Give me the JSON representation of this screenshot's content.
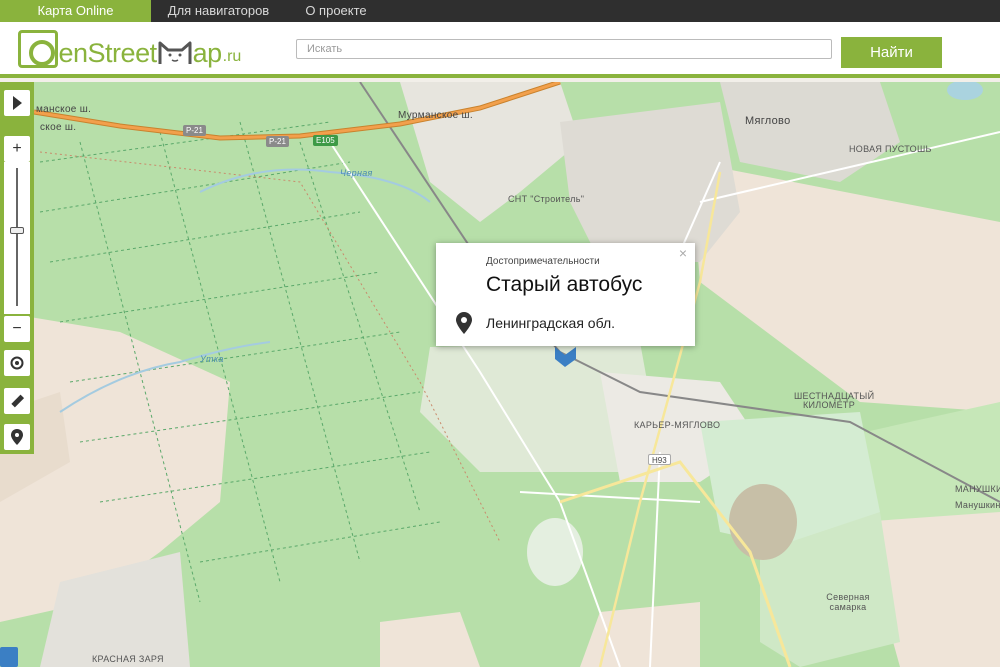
{
  "nav": {
    "tabs": [
      {
        "label": "Карта Online",
        "active": true
      },
      {
        "label": "Для навигаторов",
        "active": false
      },
      {
        "label": "О проекте",
        "active": false
      }
    ]
  },
  "header": {
    "logo_text": "penStreet",
    "logo_text2": "ap",
    "logo_suffix": ".ru",
    "search_placeholder": "Искать",
    "search_button": "Найти"
  },
  "toolbar": {
    "expand_icon": "chevron-right-icon",
    "zoom_in": "+",
    "zoom_out": "−",
    "zoom_level_fraction": 0.55,
    "tools": [
      "locate-icon",
      "ruler-icon",
      "pin-icon"
    ]
  },
  "popup": {
    "category": "Достопримечательности",
    "title": "Старый автобус",
    "address": "Ленинградская обл.",
    "close": "×"
  },
  "map_labels": {
    "road_1": "манское ш.",
    "road_2": "Р-21",
    "road_3": "Мурманское ш.",
    "road_4": "Р-21",
    "road_5": "E105",
    "road_6": "Р-21",
    "river_1": "Черная",
    "river_2": "Утка",
    "place_1": "Мяглово",
    "place_2": "НОВАЯ ПУСТОШЬ",
    "place_3": "СНТ \"Строитель\"",
    "place_4": "ШЕСТНАДЦАТЫЙ КИЛОМЕТР",
    "place_5": "КАРЬЕР-МЯГЛОВО",
    "place_6": "Н93",
    "place_7": "МАНУШКИНО",
    "place_8": "Манушкино",
    "place_9": "Северная самарка",
    "place_10": "КРАСНАЯ ЗАРЯ",
    "road_7": "ское ш."
  },
  "colors": {
    "accent": "#8ab33d",
    "forest": "#b7dfa9",
    "farmland": "#efe4d8",
    "motorway": "#f2a04c",
    "marker": "#3b7fc4"
  }
}
